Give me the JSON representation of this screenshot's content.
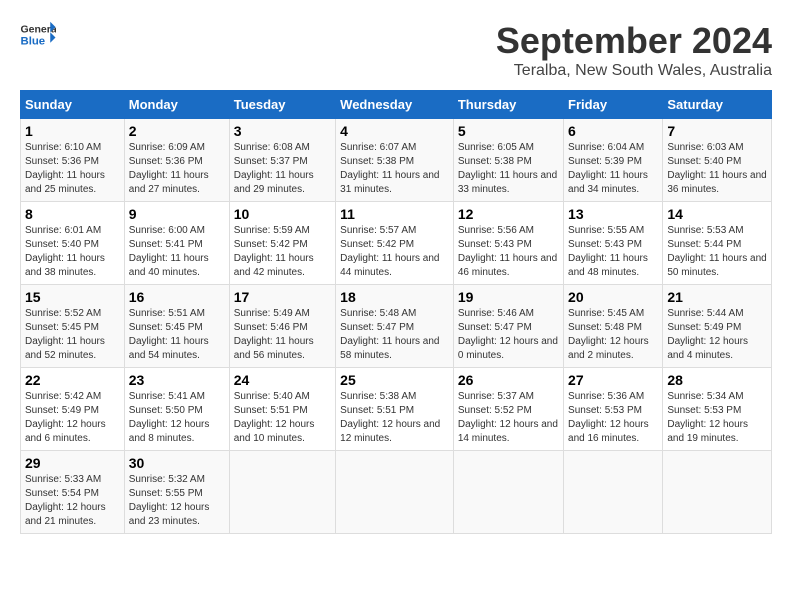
{
  "header": {
    "logo_line1": "General",
    "logo_line2": "Blue",
    "month_title": "September 2024",
    "location": "Teralba, New South Wales, Australia"
  },
  "days_of_week": [
    "Sunday",
    "Monday",
    "Tuesday",
    "Wednesday",
    "Thursday",
    "Friday",
    "Saturday"
  ],
  "weeks": [
    [
      {
        "day": "1",
        "sunrise": "6:10 AM",
        "sunset": "5:36 PM",
        "daylight": "11 hours and 25 minutes."
      },
      {
        "day": "2",
        "sunrise": "6:09 AM",
        "sunset": "5:36 PM",
        "daylight": "11 hours and 27 minutes."
      },
      {
        "day": "3",
        "sunrise": "6:08 AM",
        "sunset": "5:37 PM",
        "daylight": "11 hours and 29 minutes."
      },
      {
        "day": "4",
        "sunrise": "6:07 AM",
        "sunset": "5:38 PM",
        "daylight": "11 hours and 31 minutes."
      },
      {
        "day": "5",
        "sunrise": "6:05 AM",
        "sunset": "5:38 PM",
        "daylight": "11 hours and 33 minutes."
      },
      {
        "day": "6",
        "sunrise": "6:04 AM",
        "sunset": "5:39 PM",
        "daylight": "11 hours and 34 minutes."
      },
      {
        "day": "7",
        "sunrise": "6:03 AM",
        "sunset": "5:40 PM",
        "daylight": "11 hours and 36 minutes."
      }
    ],
    [
      {
        "day": "8",
        "sunrise": "6:01 AM",
        "sunset": "5:40 PM",
        "daylight": "11 hours and 38 minutes."
      },
      {
        "day": "9",
        "sunrise": "6:00 AM",
        "sunset": "5:41 PM",
        "daylight": "11 hours and 40 minutes."
      },
      {
        "day": "10",
        "sunrise": "5:59 AM",
        "sunset": "5:42 PM",
        "daylight": "11 hours and 42 minutes."
      },
      {
        "day": "11",
        "sunrise": "5:57 AM",
        "sunset": "5:42 PM",
        "daylight": "11 hours and 44 minutes."
      },
      {
        "day": "12",
        "sunrise": "5:56 AM",
        "sunset": "5:43 PM",
        "daylight": "11 hours and 46 minutes."
      },
      {
        "day": "13",
        "sunrise": "5:55 AM",
        "sunset": "5:43 PM",
        "daylight": "11 hours and 48 minutes."
      },
      {
        "day": "14",
        "sunrise": "5:53 AM",
        "sunset": "5:44 PM",
        "daylight": "11 hours and 50 minutes."
      }
    ],
    [
      {
        "day": "15",
        "sunrise": "5:52 AM",
        "sunset": "5:45 PM",
        "daylight": "11 hours and 52 minutes."
      },
      {
        "day": "16",
        "sunrise": "5:51 AM",
        "sunset": "5:45 PM",
        "daylight": "11 hours and 54 minutes."
      },
      {
        "day": "17",
        "sunrise": "5:49 AM",
        "sunset": "5:46 PM",
        "daylight": "11 hours and 56 minutes."
      },
      {
        "day": "18",
        "sunrise": "5:48 AM",
        "sunset": "5:47 PM",
        "daylight": "11 hours and 58 minutes."
      },
      {
        "day": "19",
        "sunrise": "5:46 AM",
        "sunset": "5:47 PM",
        "daylight": "12 hours and 0 minutes."
      },
      {
        "day": "20",
        "sunrise": "5:45 AM",
        "sunset": "5:48 PM",
        "daylight": "12 hours and 2 minutes."
      },
      {
        "day": "21",
        "sunrise": "5:44 AM",
        "sunset": "5:49 PM",
        "daylight": "12 hours and 4 minutes."
      }
    ],
    [
      {
        "day": "22",
        "sunrise": "5:42 AM",
        "sunset": "5:49 PM",
        "daylight": "12 hours and 6 minutes."
      },
      {
        "day": "23",
        "sunrise": "5:41 AM",
        "sunset": "5:50 PM",
        "daylight": "12 hours and 8 minutes."
      },
      {
        "day": "24",
        "sunrise": "5:40 AM",
        "sunset": "5:51 PM",
        "daylight": "12 hours and 10 minutes."
      },
      {
        "day": "25",
        "sunrise": "5:38 AM",
        "sunset": "5:51 PM",
        "daylight": "12 hours and 12 minutes."
      },
      {
        "day": "26",
        "sunrise": "5:37 AM",
        "sunset": "5:52 PM",
        "daylight": "12 hours and 14 minutes."
      },
      {
        "day": "27",
        "sunrise": "5:36 AM",
        "sunset": "5:53 PM",
        "daylight": "12 hours and 16 minutes."
      },
      {
        "day": "28",
        "sunrise": "5:34 AM",
        "sunset": "5:53 PM",
        "daylight": "12 hours and 19 minutes."
      }
    ],
    [
      {
        "day": "29",
        "sunrise": "5:33 AM",
        "sunset": "5:54 PM",
        "daylight": "12 hours and 21 minutes."
      },
      {
        "day": "30",
        "sunrise": "5:32 AM",
        "sunset": "5:55 PM",
        "daylight": "12 hours and 23 minutes."
      },
      {
        "day": "",
        "sunrise": "",
        "sunset": "",
        "daylight": ""
      },
      {
        "day": "",
        "sunrise": "",
        "sunset": "",
        "daylight": ""
      },
      {
        "day": "",
        "sunrise": "",
        "sunset": "",
        "daylight": ""
      },
      {
        "day": "",
        "sunrise": "",
        "sunset": "",
        "daylight": ""
      },
      {
        "day": "",
        "sunrise": "",
        "sunset": "",
        "daylight": ""
      }
    ]
  ],
  "labels": {
    "sunrise": "Sunrise:",
    "sunset": "Sunset:",
    "daylight": "Daylight:"
  }
}
